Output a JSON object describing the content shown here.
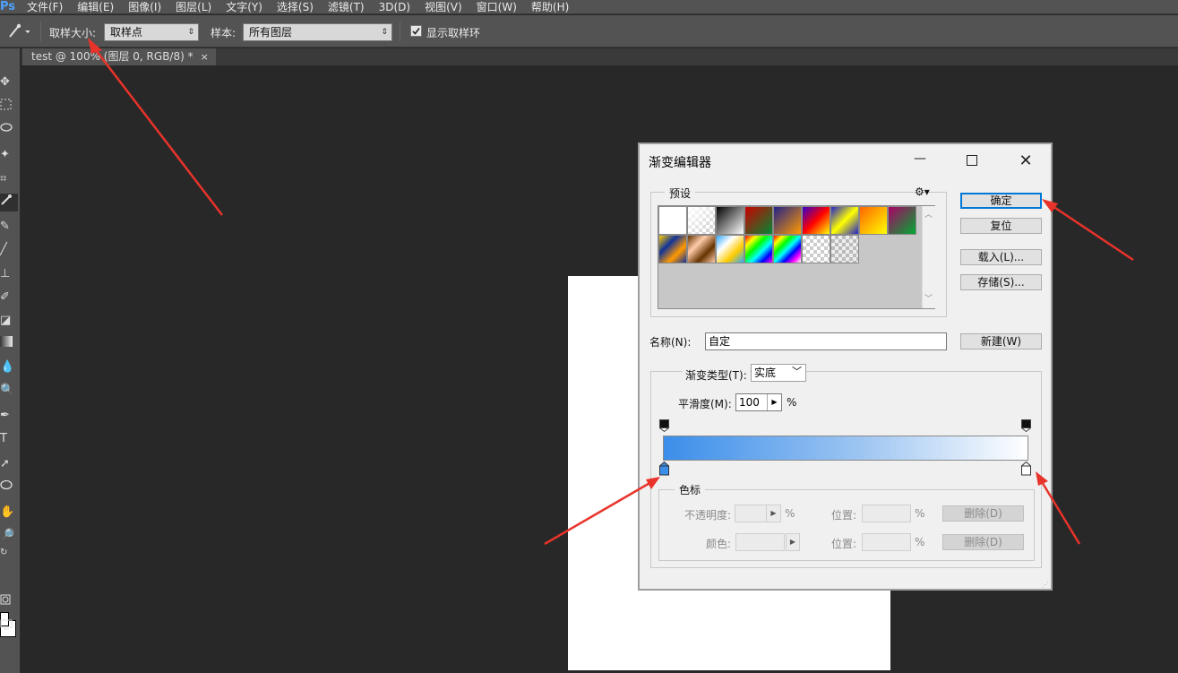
{
  "menubar": {
    "logo": "Ps",
    "items": [
      "文件(F)",
      "编辑(E)",
      "图像(I)",
      "图层(L)",
      "文字(Y)",
      "选择(S)",
      "滤镜(T)",
      "3D(D)",
      "视图(V)",
      "窗口(W)",
      "帮助(H)"
    ]
  },
  "options": {
    "sample_size_label": "取样大小:",
    "sample_size_value": "取样点",
    "sample_label": "样本:",
    "sample_value": "所有图层",
    "show_ring_label": "显示取样环",
    "show_ring_checked": true
  },
  "document_tab": {
    "title": "test @ 100% (图层 0, RGB/8) *",
    "close": "×"
  },
  "tools": [
    "move-tool",
    "marquee-tool",
    "lasso-tool",
    "magic-wand-tool",
    "crop-tool",
    "eyedropper-tool",
    "healing-brush-tool",
    "brush-tool",
    "clone-stamp-tool",
    "history-brush-tool",
    "eraser-tool",
    "gradient-tool",
    "blur-tool",
    "dodge-tool",
    "pen-tool",
    "type-tool",
    "path-selection-tool",
    "shape-tool",
    "hand-tool",
    "zoom-tool"
  ],
  "dialog": {
    "title": "渐变编辑器",
    "presets_label": "预设",
    "buttons": {
      "ok": "确定",
      "reset": "复位",
      "load": "载入(L)...",
      "save": "存储(S)...",
      "new": "新建(W)"
    },
    "name_label": "名称(N):",
    "name_value": "自定",
    "gradient_type_label": "渐变类型(T):",
    "gradient_type_value": "实底",
    "smoothness_label": "平滑度(M):",
    "smoothness_value": "100",
    "percent": "%",
    "stops_label": "色标",
    "opacity_label": "不透明度:",
    "location_label": "位置:",
    "color_label": "颜色:",
    "delete_label": "删除(D)",
    "gradient_colors": [
      "#3b8eea",
      "#ffffff"
    ]
  }
}
